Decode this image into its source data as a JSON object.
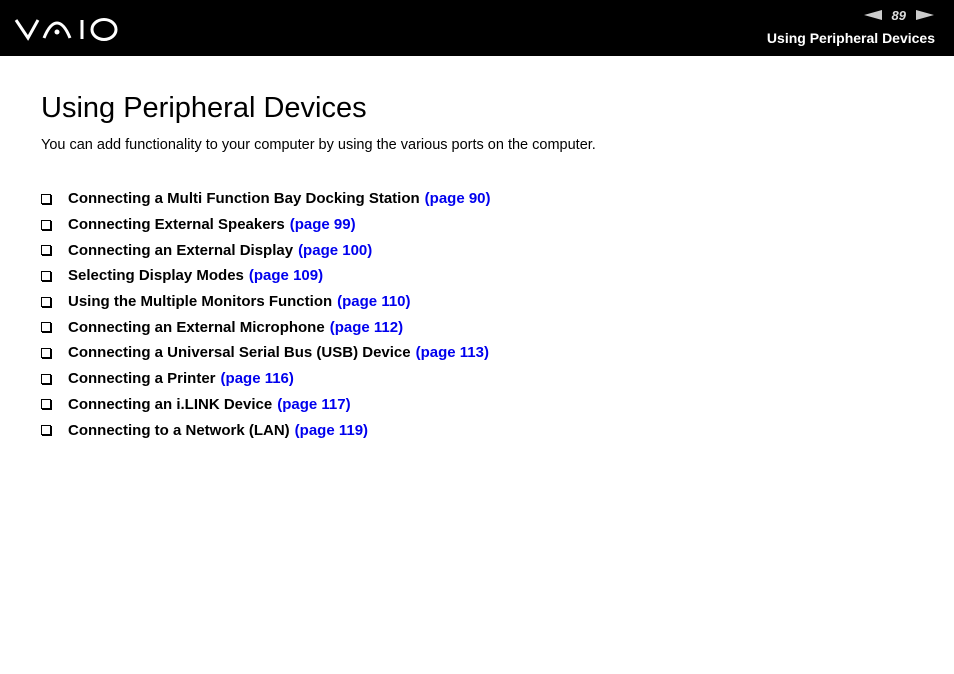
{
  "header": {
    "brand": "VAIO",
    "page_number": "89",
    "section_title": "Using Peripheral Devices"
  },
  "main": {
    "title": "Using Peripheral Devices",
    "intro": "You can add functionality to your computer by using the various ports on the computer.",
    "items": [
      {
        "label": "Connecting a Multi Function Bay Docking Station",
        "link": "(page 90)"
      },
      {
        "label": "Connecting External Speakers",
        "link": "(page 99)"
      },
      {
        "label": "Connecting an External Display",
        "link": "(page 100)"
      },
      {
        "label": "Selecting Display Modes",
        "link": "(page 109)"
      },
      {
        "label": "Using the Multiple Monitors Function",
        "link": "(page 110)"
      },
      {
        "label": "Connecting an External Microphone",
        "link": "(page 112)"
      },
      {
        "label": "Connecting a Universal Serial Bus (USB) Device",
        "link": "(page 113)"
      },
      {
        "label": "Connecting a Printer",
        "link": "(page 116)"
      },
      {
        "label": "Connecting an i.LINK Device",
        "link": "(page 117)"
      },
      {
        "label": "Connecting to a Network (LAN)",
        "link": "(page 119)"
      }
    ]
  }
}
